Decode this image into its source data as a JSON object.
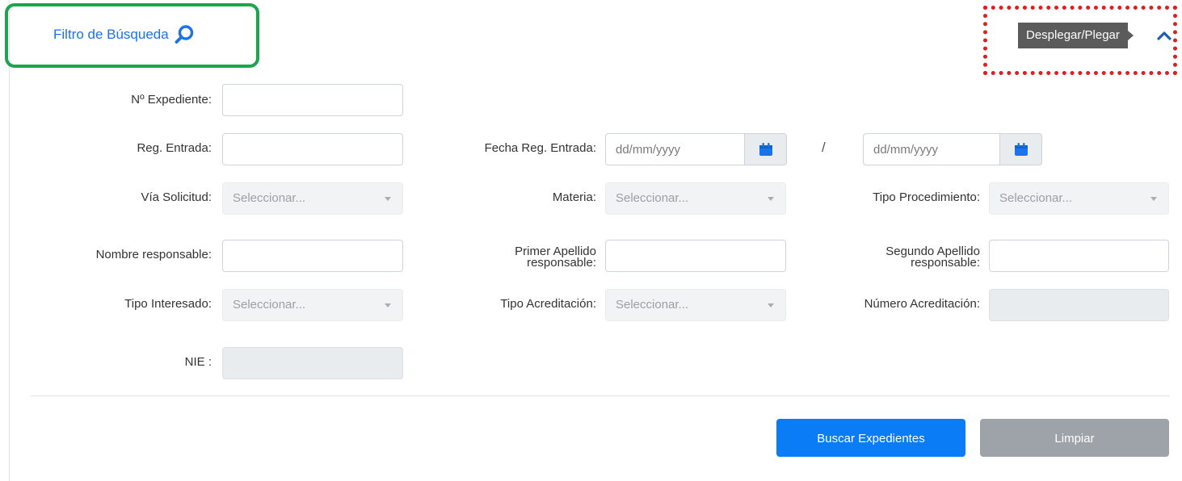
{
  "panel": {
    "title": "Filtro de Búsqueda",
    "toggle_tooltip": "Desplegar/Plegar"
  },
  "fields": {
    "expediente": {
      "label": "Nº Expediente:",
      "value": ""
    },
    "reg_entrada": {
      "label": "Reg. Entrada:",
      "value": ""
    },
    "fecha_reg_entrada": {
      "label": "Fecha Reg. Entrada:",
      "from_placeholder": "dd/mm/yyyy",
      "separator": "/",
      "to_placeholder": "dd/mm/yyyy"
    },
    "via_solicitud": {
      "label": "Vía Solicitud:",
      "selected": "Seleccionar..."
    },
    "materia": {
      "label": "Materia:",
      "selected": "Seleccionar..."
    },
    "tipo_procedimiento": {
      "label": "Tipo Procedimiento:",
      "selected": "Seleccionar..."
    },
    "nombre_responsable": {
      "label": "Nombre responsable:",
      "value": ""
    },
    "primer_apellido": {
      "label_line1": "Primer Apellido",
      "label_line2": "responsable:",
      "value": ""
    },
    "segundo_apellido": {
      "label_line1": "Segundo Apellido",
      "label_line2": "responsable:",
      "value": ""
    },
    "tipo_interesado": {
      "label": "Tipo Interesado:",
      "selected": "Seleccionar..."
    },
    "tipo_acreditacion": {
      "label": "Tipo Acreditación:",
      "selected": "Seleccionar..."
    },
    "numero_acreditacion": {
      "label": "Número Acreditación:",
      "value": ""
    },
    "nie": {
      "label": "NIE :",
      "value": ""
    }
  },
  "actions": {
    "search_label": "Buscar Expedientes",
    "clear_label": "Limpiar"
  },
  "colors": {
    "accent": "#1a73e8",
    "primary_button": "#0a7cf5",
    "secondary_button": "#9ea3a9",
    "highlight_green": "#1aa64a",
    "highlight_red": "#e01e1e"
  }
}
